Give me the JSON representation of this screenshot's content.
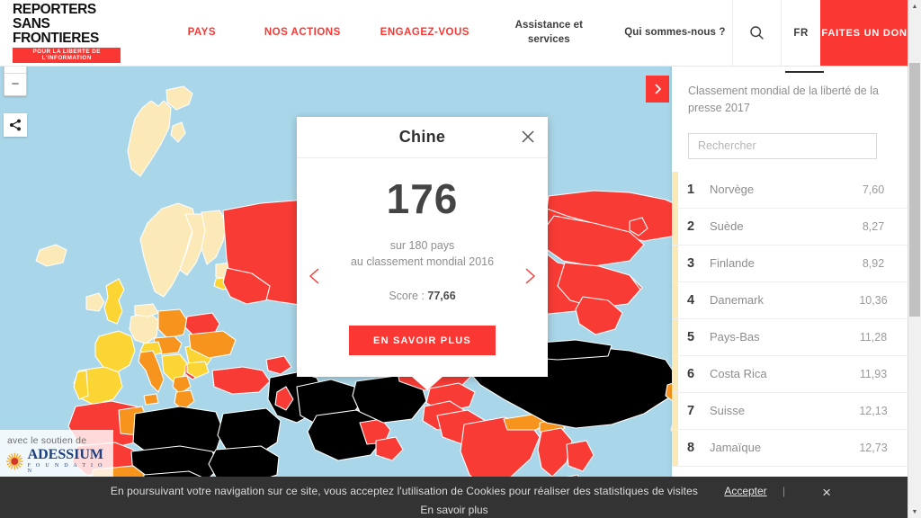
{
  "header": {
    "logo": {
      "line1": "REPORTERS",
      "line2": "SANS FRONTIERES",
      "tagline": "POUR LA LIBERTE DE L'INFORMATION"
    },
    "nav": [
      {
        "label": "PAYS",
        "style": "red"
      },
      {
        "label": "NOS ACTIONS",
        "style": "red"
      },
      {
        "label": "ENGAGEZ-VOUS",
        "style": "red"
      },
      {
        "label": "Assistance et services",
        "style": "dark"
      },
      {
        "label": "Qui sommes-nous ?",
        "style": "dark"
      }
    ],
    "search_icon": "search-icon",
    "lang": "FR",
    "donate": "FAITES UN DON",
    "brand_red": "#FA3732"
  },
  "map": {
    "zoom_in": "+",
    "zoom_out": "−",
    "share_icon": "share-icon",
    "next_icon": "chevron-right-icon",
    "ocean_color": "#A9D6E8",
    "legend_colors": {
      "good": "#FCE9B8",
      "fairly_good": "#FBD534",
      "problematic": "#F7941E",
      "difficult": "#F93B35",
      "very_serious": "#000000"
    },
    "sponsor": {
      "prefix": "avec le soutien de",
      "name": "ADESSIUM",
      "subtitle": "F O U N D A T I O N"
    }
  },
  "popup": {
    "country": "Chine",
    "close_icon": "close-icon",
    "prev_icon": "chevron-left-icon",
    "next_icon": "chevron-right-icon",
    "rank": "176",
    "subline1": "sur 180 pays",
    "subline2": "au classement mondial 2016",
    "score_label": "Score :",
    "score_value": "77,66",
    "cta": "EN SAVOIR PLUS"
  },
  "panel": {
    "title_prefix": "Classement ",
    "title_year": "2017",
    "description": "Classement mondial de la liberté de la presse 2017",
    "search_placeholder": "Rechercher",
    "search_value": "",
    "rows": [
      {
        "rank": "1",
        "country": "Norvège",
        "score": "7,60",
        "stripe": "#FCE9B8"
      },
      {
        "rank": "2",
        "country": "Suède",
        "score": "8,27",
        "stripe": "#FCE9B8"
      },
      {
        "rank": "3",
        "country": "Finlande",
        "score": "8,92",
        "stripe": "#FCE9B8"
      },
      {
        "rank": "4",
        "country": "Danemark",
        "score": "10,36",
        "stripe": "#FCE9B8"
      },
      {
        "rank": "5",
        "country": "Pays-Bas",
        "score": "11,28",
        "stripe": "#FCE9B8"
      },
      {
        "rank": "6",
        "country": "Costa Rica",
        "score": "11,93",
        "stripe": "#FCE9B8"
      },
      {
        "rank": "7",
        "country": "Suisse",
        "score": "12,13",
        "stripe": "#FCE9B8"
      },
      {
        "rank": "8",
        "country": "Jamaïque",
        "score": "12,73",
        "stripe": "#FCE9B8"
      }
    ]
  },
  "cookie": {
    "text": "En poursuivant votre navigation sur ce site, vous acceptez l'utilisation de Cookies pour réaliser des statistiques de visites",
    "accept": "Accepter",
    "separator": "|",
    "close": "×",
    "more": "En savoir plus"
  }
}
